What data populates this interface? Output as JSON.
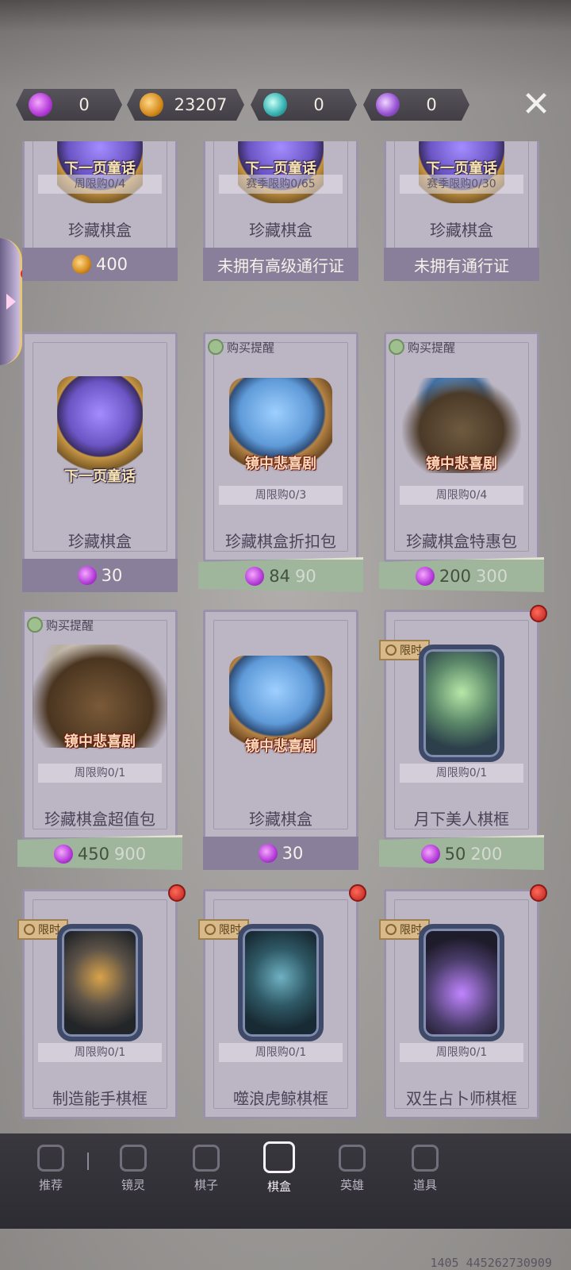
{
  "currencies": [
    {
      "name": "candy-plus",
      "icon": "candy-plus-icon",
      "value": "0"
    },
    {
      "name": "pumpkin-coin",
      "icon": "pumpkin-coin-icon",
      "value": "23207"
    },
    {
      "name": "teal-orb",
      "icon": "teal-orb-icon",
      "value": "0"
    },
    {
      "name": "purple-orb",
      "icon": "purple-orb-icon",
      "value": "0"
    }
  ],
  "close_label": "✕",
  "items": [
    {
      "art_text": "下一页童话",
      "limit": "周限购0/4",
      "title": "珍藏棋盒",
      "price": "400",
      "price_icon": "pumpkin"
    },
    {
      "art_text": "下一页童话",
      "limit": "赛季限购0/65",
      "title": "珍藏棋盒",
      "price": "未拥有高级通行证"
    },
    {
      "art_text": "下一页童话",
      "limit": "赛季限购0/30",
      "title": "珍藏棋盒",
      "price": "未拥有通行证"
    },
    {
      "art_text": "下一页童话",
      "limit": "",
      "title": "珍藏棋盒",
      "price": "30",
      "price_icon": "candy"
    },
    {
      "remind": "购买提醒",
      "art_text": "镜中悲喜剧",
      "limit": "周限购0/3",
      "title": "珍藏棋盒折扣包",
      "price_now": "84",
      "price_old": "90"
    },
    {
      "remind": "购买提醒",
      "art_text": "镜中悲喜剧",
      "limit": "周限购0/4",
      "title": "珍藏棋盒特惠包",
      "price_now": "200",
      "price_old": "300"
    },
    {
      "remind": "购买提醒",
      "art_text": "镜中悲喜剧",
      "limit": "周限购0/1",
      "title": "珍藏棋盒超值包",
      "price_now": "450",
      "price_old": "900"
    },
    {
      "art_text": "镜中悲喜剧",
      "limit": "",
      "title": "珍藏棋盒",
      "price": "30",
      "price_icon": "candy"
    },
    {
      "tag": "限时",
      "limit": "周限购0/1",
      "title": "月下美人棋框",
      "price_now": "50",
      "price_old": "200"
    },
    {
      "tag": "限时",
      "limit": "周限购0/1",
      "title": "制造能手棋框"
    },
    {
      "tag": "限时",
      "limit": "周限购0/1",
      "title": "噬浪虎鲸棋框"
    },
    {
      "tag": "限时",
      "limit": "周限购0/1",
      "title": "双生占卜师棋框"
    }
  ],
  "nav": [
    {
      "label": "推荐"
    },
    {
      "label": "镜灵"
    },
    {
      "label": "棋子"
    },
    {
      "label": "棋盒",
      "active": true
    },
    {
      "label": "英雄"
    },
    {
      "label": "道具"
    }
  ],
  "footer_code": "1405 445262730909"
}
